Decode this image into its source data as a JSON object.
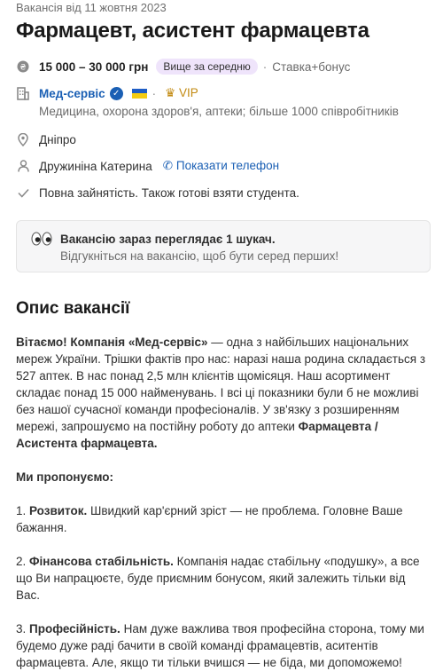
{
  "header": {
    "posted": "Вакансія від 11 жовтня 2023",
    "title": "Фармацевт, асистент фармацевта"
  },
  "salary": {
    "amount": "15 000 – 30 000 грн",
    "badge": "Вище за середню",
    "extra": "Ставка+бонус"
  },
  "company": {
    "name": "Мед-сервіс",
    "vip": "VIP",
    "details": "Медицина, охорона здоров'я, аптеки; більше 1000 співробітників"
  },
  "city": "Дніпро",
  "contact": {
    "name": "Дружиніна Катерина",
    "phone_link": "Показати телефон"
  },
  "employment": "Повна зайнятість. Також готові взяти студента.",
  "notice": {
    "title": "Вакансію зараз переглядає 1 шукач.",
    "subtitle": "Відгукніться на вакансію, щоб бути серед перших!"
  },
  "description": {
    "heading": "Опис вакансії",
    "p1_bold": "Вітаємо! Компанія «Мед-сервіс»",
    "p1_text": " — одна з найбільших національних мереж України. Трішки фактів про нас: наразі наша родина складається з 527 аптек. В нас понад 2,5 млн клієнтів щомісяця. Наш асортимент складає понад 15 000 найменувань. І всі ці показники були б не можливі без нашої сучасної команди професіоналів. У зв'язку з розширенням мережі, запрошуємо на постійну роботу до аптеки ",
    "p1_bold2": "Фармацевта / Асистента фармацевта.",
    "offer_heading": "Ми пропонуємо:",
    "item1_prefix": "1. ",
    "item1_bold": "Розвиток.",
    "item1_text": " Швидкий кар'єрний зріст — не проблема. Головне Ваше бажання.",
    "item2_prefix": "2. ",
    "item2_bold": "Фінансова стабільність.",
    "item2_text": " Компанія надає стабільну «подушку», а все що Ви напрацюєте, буде приємним бонусом, який залежить тільки від Вас.",
    "item3_prefix": "3. ",
    "item3_bold": "Професійність.",
    "item3_text": " Нам дуже важлива твоя професійна сторона, тому ми будемо дуже раді бачити в своїй команді фрамацевтів, аситентів фармацевта. Але, якщо ти тільки вчишся — не біда, ми допоможемо!"
  },
  "icons": {
    "salary": "salary-coin-icon",
    "company": "building-icon",
    "verified": "verified-check-icon",
    "flag": "ukraine-flag-icon",
    "vip": "crown-icon",
    "location": "location-pin-icon",
    "person": "person-icon",
    "phone": "phone-icon",
    "check": "checkmark-icon",
    "eyes": "eyes-icon"
  }
}
